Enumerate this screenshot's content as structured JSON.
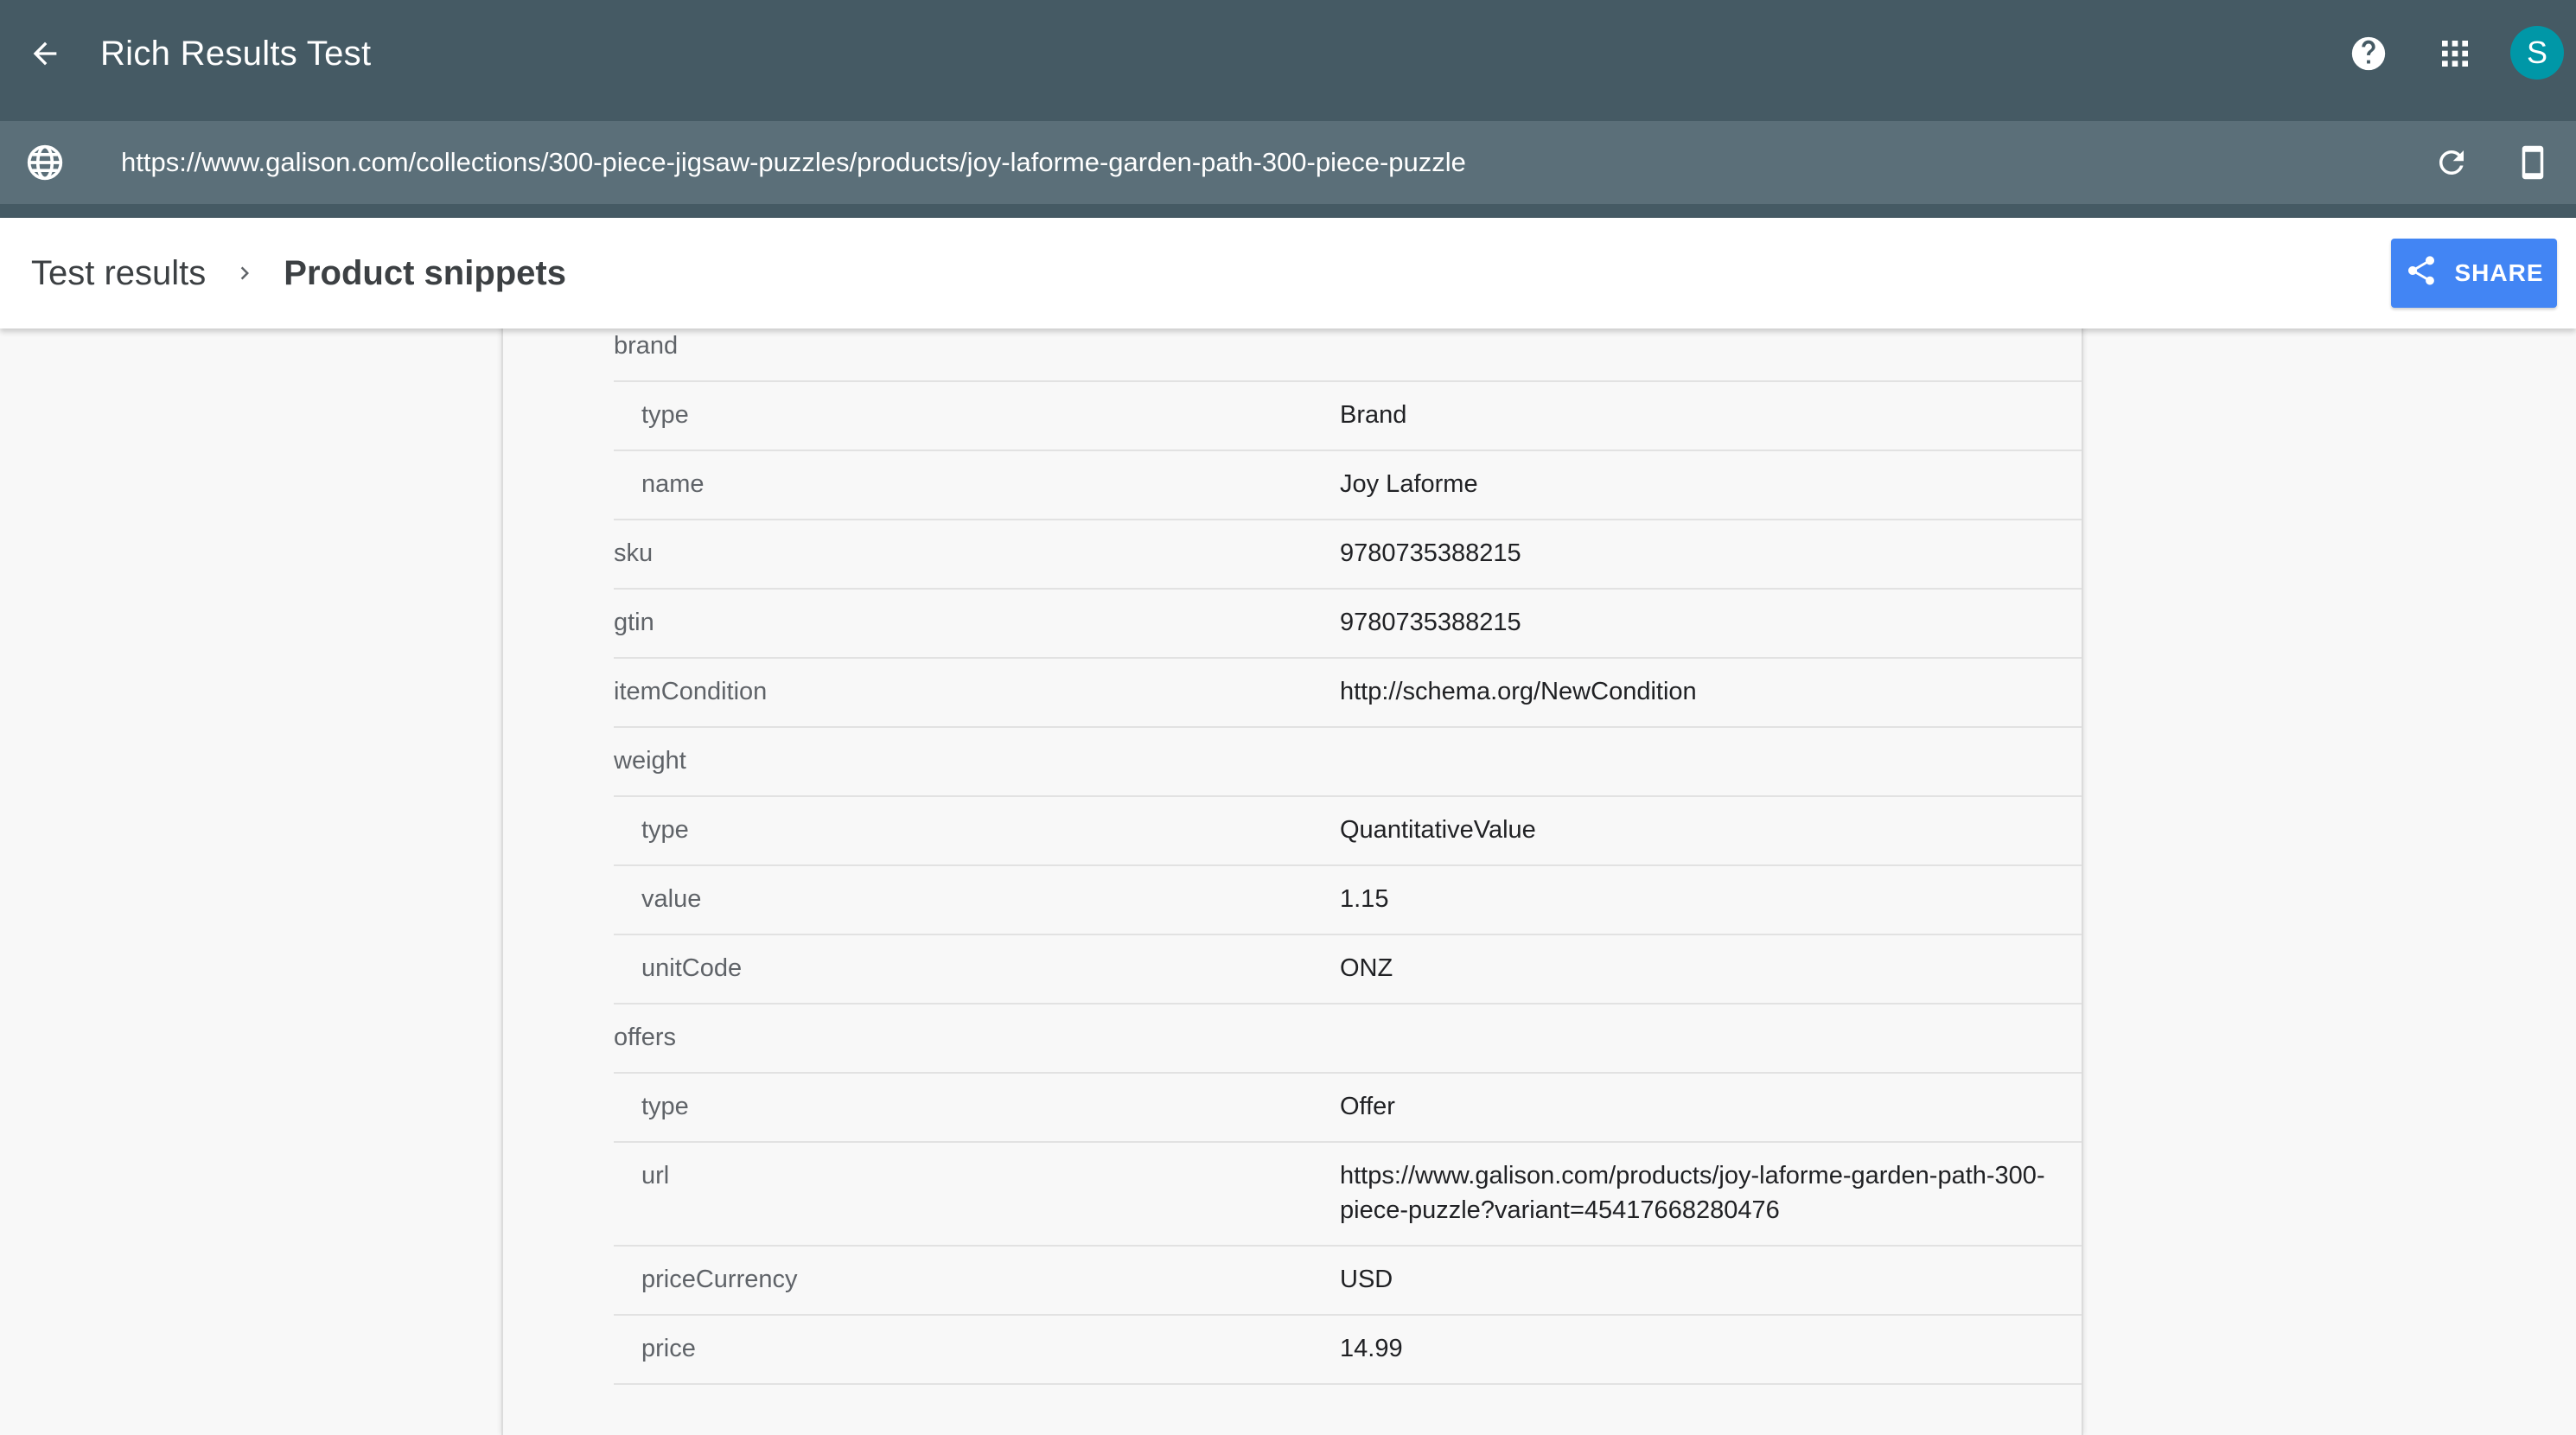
{
  "appbar": {
    "title": "Rich Results Test",
    "back_icon": "arrow-left-icon",
    "help_icon": "help-circle-icon",
    "apps_icon": "apps-grid-icon",
    "avatar_letter": "S",
    "avatar_color": "#0097a7",
    "background": "#455a64"
  },
  "urlbar": {
    "url": "https://www.galison.com/collections/300-piece-jigsaw-puzzles/products/joy-laforme-garden-path-300-piece-puzzle",
    "globe_icon": "globe-icon",
    "refresh_icon": "refresh-icon",
    "device_icon": "smartphone-icon"
  },
  "header": {
    "crumb_parent": "Test results",
    "crumb_current": "Product snippets",
    "share_label": "SHARE",
    "share_color": "#4285f4"
  },
  "properties": [
    {
      "key": "brand",
      "value": "",
      "level": 0
    },
    {
      "key": "type",
      "value": "Brand",
      "level": 1
    },
    {
      "key": "name",
      "value": "Joy Laforme",
      "level": 1
    },
    {
      "key": "sku",
      "value": "9780735388215",
      "level": 0
    },
    {
      "key": "gtin",
      "value": "9780735388215",
      "level": 0
    },
    {
      "key": "itemCondition",
      "value": "http://schema.org/NewCondition",
      "level": 0
    },
    {
      "key": "weight",
      "value": "",
      "level": 0
    },
    {
      "key": "type",
      "value": "QuantitativeValue",
      "level": 1
    },
    {
      "key": "value",
      "value": "1.15",
      "level": 1
    },
    {
      "key": "unitCode",
      "value": "ONZ",
      "level": 1
    },
    {
      "key": "offers",
      "value": "",
      "level": 0
    },
    {
      "key": "type",
      "value": "Offer",
      "level": 1
    },
    {
      "key": "url",
      "value": "https://www.galison.com/products/joy-laforme-garden-path-300-piece-puzzle?variant=45417668280476",
      "level": 1
    },
    {
      "key": "priceCurrency",
      "value": "USD",
      "level": 1
    },
    {
      "key": "price",
      "value": "14.99",
      "level": 1
    }
  ]
}
